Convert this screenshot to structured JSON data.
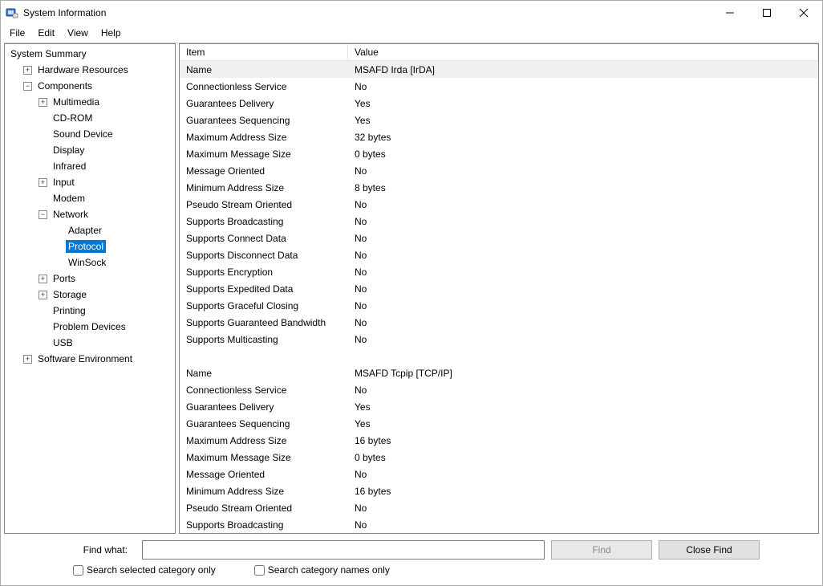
{
  "window": {
    "title": "System Information"
  },
  "menu": {
    "items": [
      "File",
      "Edit",
      "View",
      "Help"
    ]
  },
  "tree": {
    "root": {
      "label": "System Summary",
      "children": [
        {
          "label": "Hardware Resources",
          "exp": "+",
          "children": []
        },
        {
          "label": "Components",
          "exp": "-",
          "children": [
            {
              "label": "Multimedia",
              "exp": "+",
              "children": []
            },
            {
              "label": "CD-ROM"
            },
            {
              "label": "Sound Device"
            },
            {
              "label": "Display"
            },
            {
              "label": "Infrared"
            },
            {
              "label": "Input",
              "exp": "+",
              "children": []
            },
            {
              "label": "Modem"
            },
            {
              "label": "Network",
              "exp": "-",
              "children": [
                {
                  "label": "Adapter"
                },
                {
                  "label": "Protocol",
                  "selected": true
                },
                {
                  "label": "WinSock"
                }
              ]
            },
            {
              "label": "Ports",
              "exp": "+",
              "children": []
            },
            {
              "label": "Storage",
              "exp": "+",
              "children": []
            },
            {
              "label": "Printing"
            },
            {
              "label": "Problem Devices"
            },
            {
              "label": "USB"
            }
          ]
        },
        {
          "label": "Software Environment",
          "exp": "+",
          "children": []
        }
      ]
    }
  },
  "detail": {
    "columns": [
      "Item",
      "Value"
    ],
    "groups": [
      {
        "highlight_first": true,
        "rows": [
          [
            "Name",
            "MSAFD Irda [IrDA]"
          ],
          [
            "Connectionless Service",
            "No"
          ],
          [
            "Guarantees Delivery",
            "Yes"
          ],
          [
            "Guarantees Sequencing",
            "Yes"
          ],
          [
            "Maximum Address Size",
            "32 bytes"
          ],
          [
            "Maximum Message Size",
            "0 bytes"
          ],
          [
            "Message Oriented",
            "No"
          ],
          [
            "Minimum Address Size",
            "8 bytes"
          ],
          [
            "Pseudo Stream Oriented",
            "No"
          ],
          [
            "Supports Broadcasting",
            "No"
          ],
          [
            "Supports Connect Data",
            "No"
          ],
          [
            "Supports Disconnect Data",
            "No"
          ],
          [
            "Supports Encryption",
            "No"
          ],
          [
            "Supports Expedited Data",
            "No"
          ],
          [
            "Supports Graceful Closing",
            "No"
          ],
          [
            "Supports Guaranteed Bandwidth",
            "No"
          ],
          [
            "Supports Multicasting",
            "No"
          ]
        ]
      },
      {
        "highlight_first": false,
        "rows": [
          [
            "Name",
            "MSAFD Tcpip [TCP/IP]"
          ],
          [
            "Connectionless Service",
            "No"
          ],
          [
            "Guarantees Delivery",
            "Yes"
          ],
          [
            "Guarantees Sequencing",
            "Yes"
          ],
          [
            "Maximum Address Size",
            "16 bytes"
          ],
          [
            "Maximum Message Size",
            "0 bytes"
          ],
          [
            "Message Oriented",
            "No"
          ],
          [
            "Minimum Address Size",
            "16 bytes"
          ],
          [
            "Pseudo Stream Oriented",
            "No"
          ],
          [
            "Supports Broadcasting",
            "No"
          ]
        ]
      }
    ]
  },
  "find": {
    "label": "Find what:",
    "input_value": "",
    "find_btn": "Find",
    "close_btn": "Close Find",
    "chk_selected": "Search selected category only",
    "chk_names": "Search category names only"
  }
}
